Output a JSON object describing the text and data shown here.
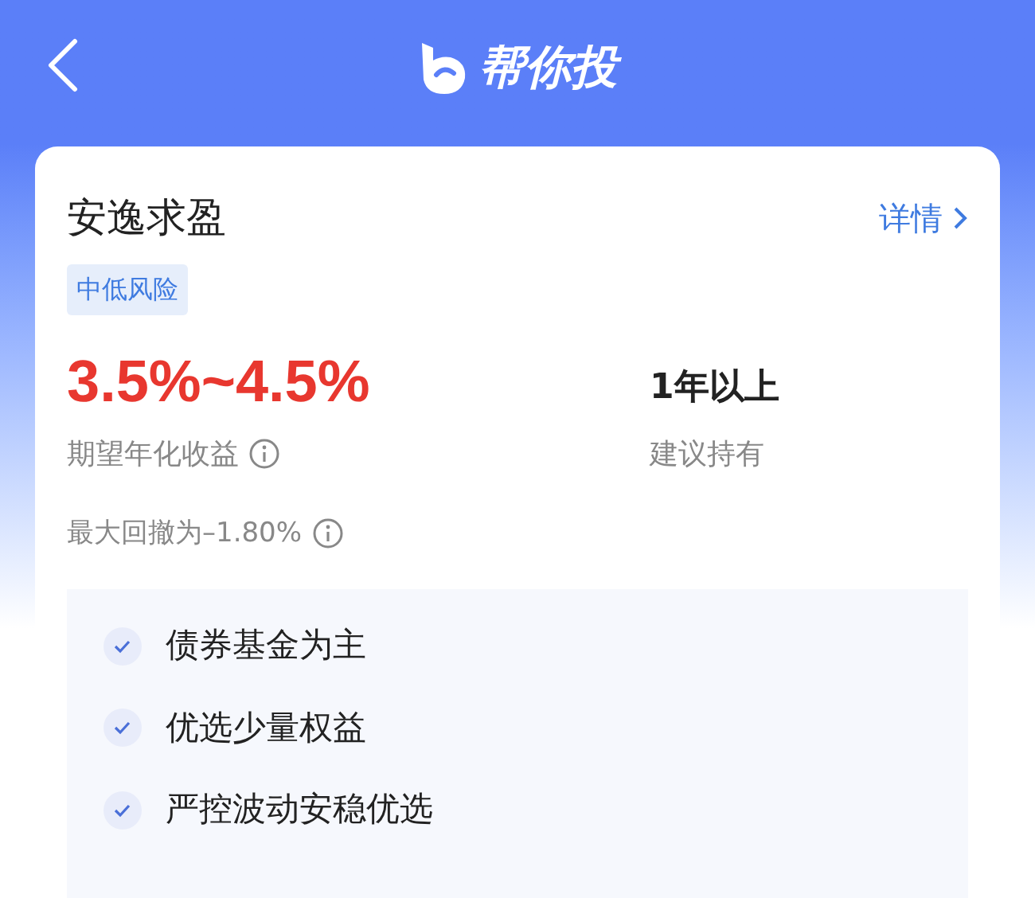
{
  "header": {
    "title": "帮你投"
  },
  "card": {
    "title": "安逸求盈",
    "detail_link": "详情",
    "risk_tag": "中低风险",
    "expected_return": {
      "value": "3.5%~4.5%",
      "label": "期望年化收益"
    },
    "holding_period": {
      "value": "1年以上",
      "label": "建议持有"
    },
    "max_drawdown": "最大回撤为–1.80%",
    "features": [
      "债券基金为主",
      "优选少量权益",
      "严控波动安稳优选"
    ]
  }
}
